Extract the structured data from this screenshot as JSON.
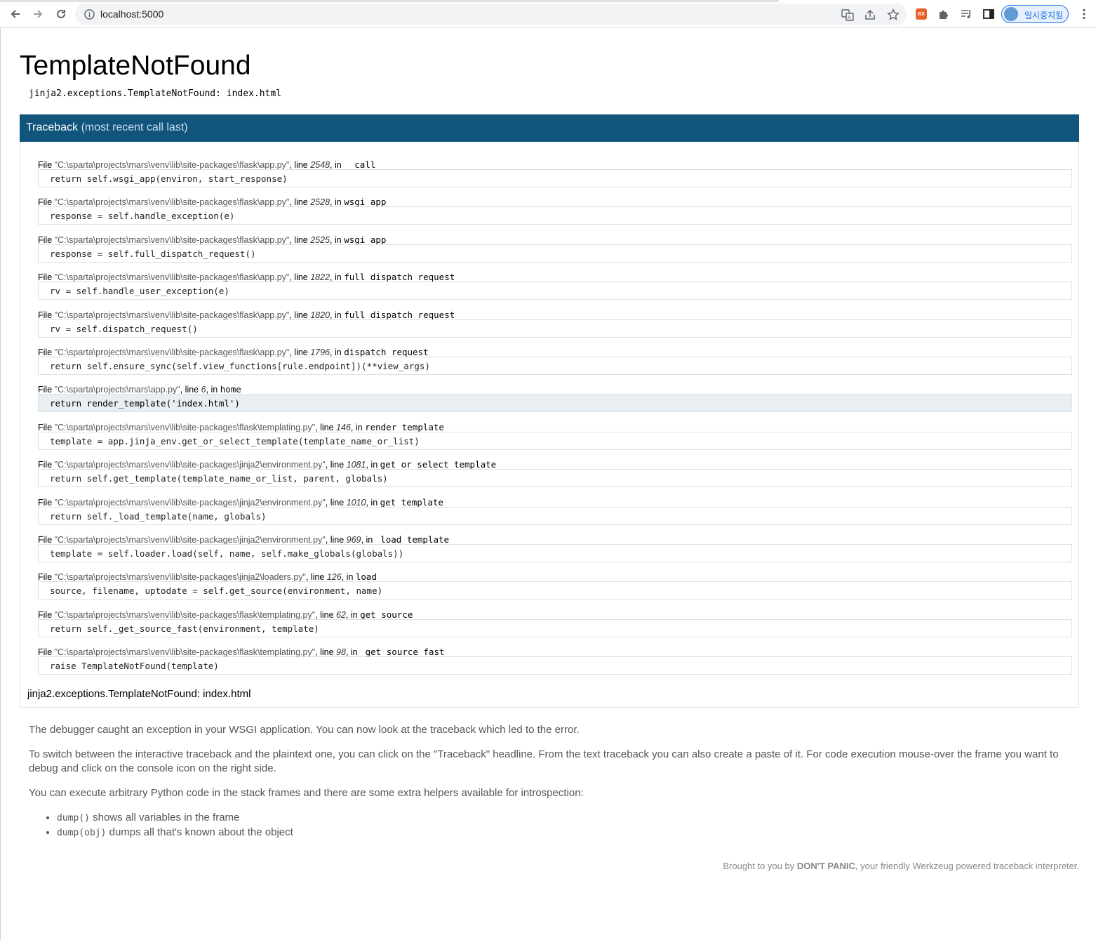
{
  "browser": {
    "url": "localhost:5000",
    "profile_label": "일시중지됨",
    "extension_badge": "BX"
  },
  "error": {
    "title": "TemplateNotFound",
    "message": "jinja2.exceptions.TemplateNotFound: index.html"
  },
  "traceback": {
    "header_main": "Traceback",
    "header_sub": "(most recent call last)",
    "footer": "jinja2.exceptions.TemplateNotFound: index.html",
    "frames": [
      {
        "file": "\"C:\\sparta\\projects\\mars\\venv\\lib\\site-packages\\flask\\app.py\"",
        "line": "2548",
        "func": "__call__",
        "code": "return self.wsgi_app(environ, start_response)"
      },
      {
        "file": "\"C:\\sparta\\projects\\mars\\venv\\lib\\site-packages\\flask\\app.py\"",
        "line": "2528",
        "func": "wsgi_app",
        "code": "response = self.handle_exception(e)"
      },
      {
        "file": "\"C:\\sparta\\projects\\mars\\venv\\lib\\site-packages\\flask\\app.py\"",
        "line": "2525",
        "func": "wsgi_app",
        "code": "response = self.full_dispatch_request()"
      },
      {
        "file": "\"C:\\sparta\\projects\\mars\\venv\\lib\\site-packages\\flask\\app.py\"",
        "line": "1822",
        "func": "full_dispatch_request",
        "code": "rv = self.handle_user_exception(e)"
      },
      {
        "file": "\"C:\\sparta\\projects\\mars\\venv\\lib\\site-packages\\flask\\app.py\"",
        "line": "1820",
        "func": "full_dispatch_request",
        "code": "rv = self.dispatch_request()"
      },
      {
        "file": "\"C:\\sparta\\projects\\mars\\venv\\lib\\site-packages\\flask\\app.py\"",
        "line": "1796",
        "func": "dispatch_request",
        "code": "return self.ensure_sync(self.view_functions[rule.endpoint])(**view_args)"
      },
      {
        "file": "\"C:\\sparta\\projects\\mars\\app.py\"",
        "line": "6",
        "func": "home",
        "code": "return render_template('index.html')"
      },
      {
        "file": "\"C:\\sparta\\projects\\mars\\venv\\lib\\site-packages\\flask\\templating.py\"",
        "line": "146",
        "func": "render_template",
        "code": "template = app.jinja_env.get_or_select_template(template_name_or_list)"
      },
      {
        "file": "\"C:\\sparta\\projects\\mars\\venv\\lib\\site-packages\\jinja2\\environment.py\"",
        "line": "1081",
        "func": "get_or_select_template",
        "code": "return self.get_template(template_name_or_list, parent, globals)"
      },
      {
        "file": "\"C:\\sparta\\projects\\mars\\venv\\lib\\site-packages\\jinja2\\environment.py\"",
        "line": "1010",
        "func": "get_template",
        "code": "return self._load_template(name, globals)"
      },
      {
        "file": "\"C:\\sparta\\projects\\mars\\venv\\lib\\site-packages\\jinja2\\environment.py\"",
        "line": "969",
        "func": "_load_template",
        "code": "template = self.loader.load(self, name, self.make_globals(globals))"
      },
      {
        "file": "\"C:\\sparta\\projects\\mars\\venv\\lib\\site-packages\\jinja2\\loaders.py\"",
        "line": "126",
        "func": "load",
        "code": "source, filename, uptodate = self.get_source(environment, name)"
      },
      {
        "file": "\"C:\\sparta\\projects\\mars\\venv\\lib\\site-packages\\flask\\templating.py\"",
        "line": "62",
        "func": "get_source",
        "code": "return self._get_source_fast(environment, template)"
      },
      {
        "file": "\"C:\\sparta\\projects\\mars\\venv\\lib\\site-packages\\flask\\templating.py\"",
        "line": "98",
        "func": "_get_source_fast",
        "code": "raise TemplateNotFound(template)"
      }
    ]
  },
  "labels": {
    "file": "File ",
    "line": ", line ",
    "in": ", in "
  },
  "explanation": {
    "p1": "The debugger caught an exception in your WSGI application. You can now look at the traceback which led to the error.",
    "p2": "To switch between the interactive traceback and the plaintext one, you can click on the \"Traceback\" headline. From the text traceback you can also create a paste of it. For code execution mouse-over the frame you want to debug and click on the console icon on the right side.",
    "p3": "You can execute arbitrary Python code in the stack frames and there are some extra helpers available for introspection:",
    "helpers": [
      {
        "code": "dump()",
        "text": " shows all variables in the frame"
      },
      {
        "code": "dump(obj)",
        "text": " dumps all that's known about the object"
      }
    ]
  },
  "footer": {
    "prefix": "Brought to you by ",
    "brand": "DON'T PANIC",
    "suffix": ", your friendly Werkzeug powered traceback interpreter."
  }
}
